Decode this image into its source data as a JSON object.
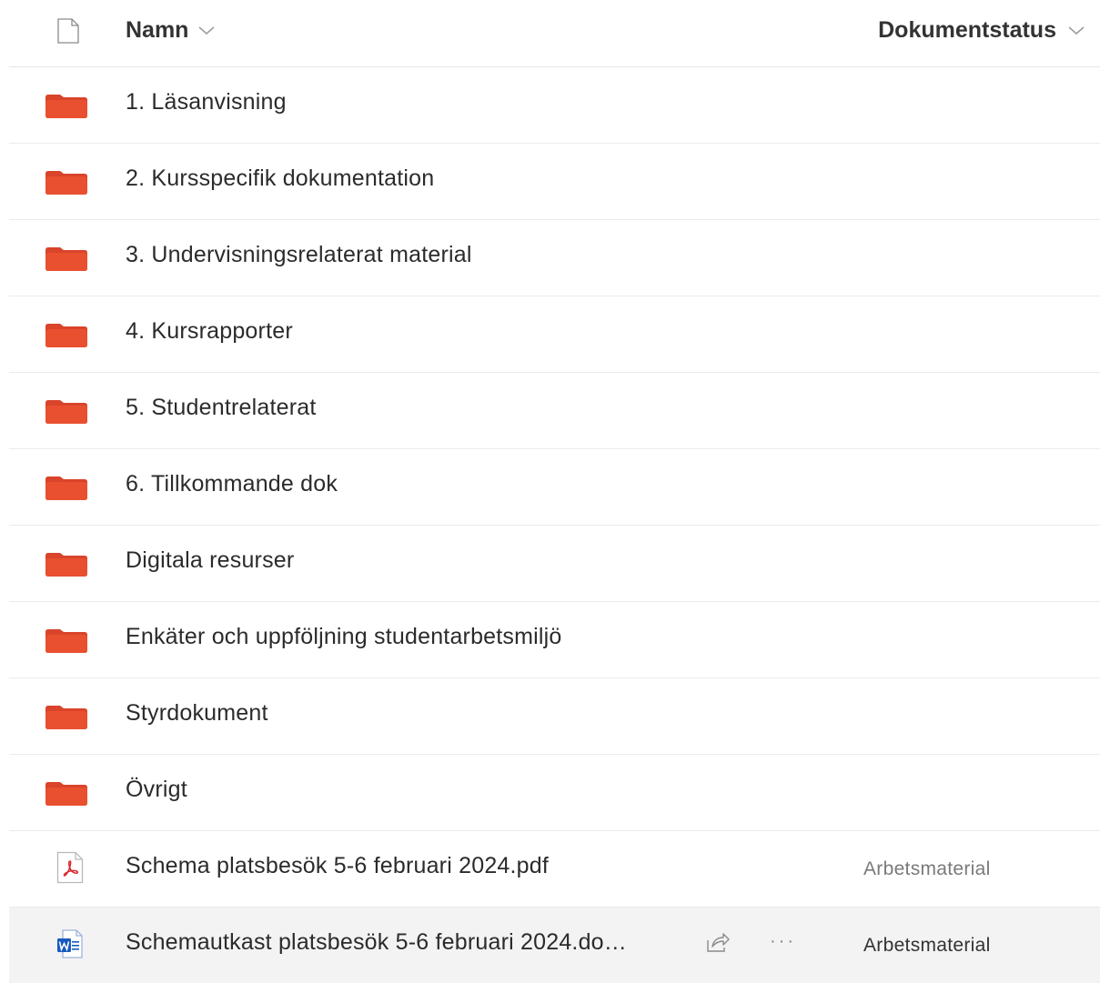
{
  "header": {
    "name_label": "Namn",
    "status_label": "Dokumentstatus"
  },
  "colors": {
    "folder": "#E8502F",
    "folder_tab": "#D9442A",
    "pdf_red": "#D9252B",
    "word_blue": "#185ABD"
  },
  "items": [
    {
      "name": "1. Läsanvisning",
      "type": "folder",
      "status": ""
    },
    {
      "name": "2. Kursspecifik dokumentation",
      "type": "folder",
      "status": ""
    },
    {
      "name": "3. Undervisningsrelaterat material",
      "type": "folder",
      "status": ""
    },
    {
      "name": "4. Kursrapporter",
      "type": "folder",
      "status": ""
    },
    {
      "name": "5. Studentrelaterat",
      "type": "folder",
      "status": ""
    },
    {
      "name": "6. Tillkommande dok",
      "type": "folder",
      "status": ""
    },
    {
      "name": "Digitala resurser",
      "type": "folder",
      "status": ""
    },
    {
      "name": "Enkäter och uppföljning studentarbetsmiljö",
      "type": "folder",
      "status": ""
    },
    {
      "name": "Styrdokument",
      "type": "folder",
      "status": ""
    },
    {
      "name": "Övrigt",
      "type": "folder",
      "status": ""
    },
    {
      "name": "Schema platsbesök 5-6 februari 2024.pdf",
      "type": "pdf",
      "status": "Arbetsmaterial"
    },
    {
      "name": "Schemautkast platsbesök 5-6 februari 2024.do…",
      "type": "word",
      "status": "Arbetsmaterial",
      "more_label": "···"
    }
  ]
}
